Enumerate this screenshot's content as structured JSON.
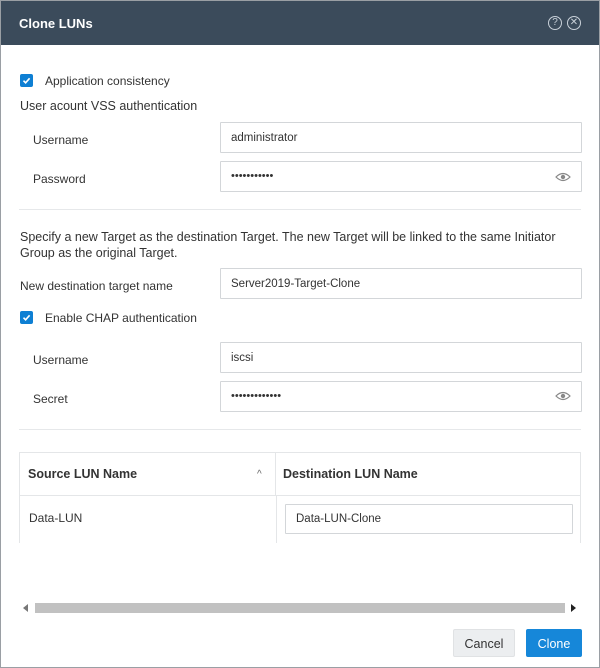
{
  "dialog": {
    "title": "Clone LUNs"
  },
  "app_consistency": {
    "label": "Application consistency",
    "checked": true
  },
  "vss": {
    "heading": "User acount VSS authentication",
    "username_label": "Username",
    "username_value": "administrator",
    "password_label": "Password",
    "password_value": "•••••••••••"
  },
  "target": {
    "description": "Specify a new Target as the destination Target. The new Target will be linked to the same Initiator Group as the original Target.",
    "name_label": "New destination target name",
    "name_value": "Server2019-Target-Clone"
  },
  "chap": {
    "label": "Enable CHAP authentication",
    "checked": true,
    "username_label": "Username",
    "username_value": "iscsi",
    "secret_label": "Secret",
    "secret_value": "•••••••••••••"
  },
  "table": {
    "headers": [
      "Source LUN Name",
      "Destination LUN Name"
    ],
    "rows": [
      {
        "source": "Data-LUN",
        "destination": "Data-LUN-Clone"
      }
    ]
  },
  "buttons": {
    "cancel": "Cancel",
    "clone": "Clone"
  },
  "icons": {
    "help": "help-icon",
    "close": "close-icon",
    "eye": "eye-icon",
    "check": "check-icon",
    "sort": "sort-asc-icon"
  },
  "colors": {
    "titlebar": "#3b4b5b",
    "accent": "#1687d9"
  }
}
